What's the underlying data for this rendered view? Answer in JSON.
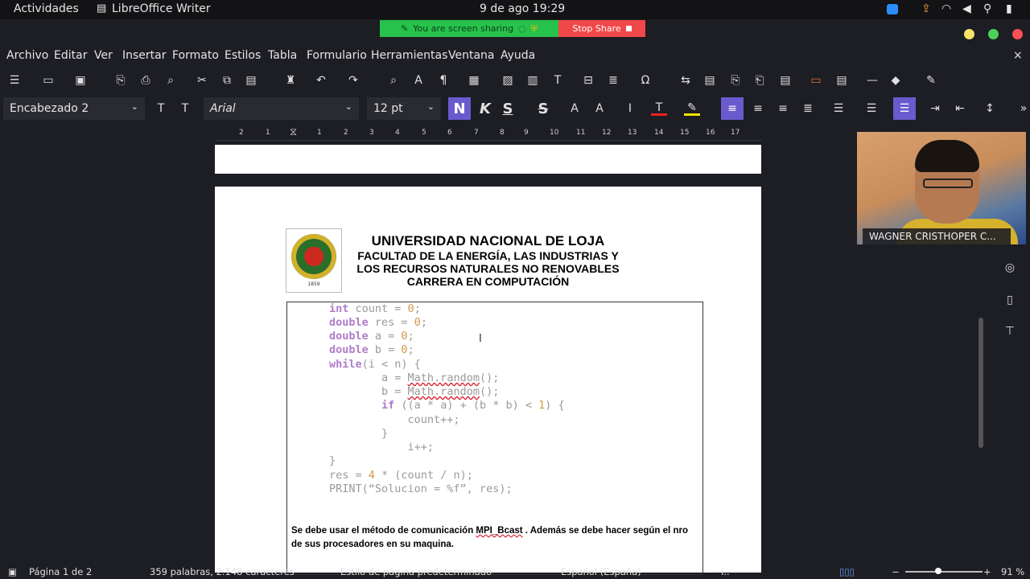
{
  "system_bar": {
    "activities": "Actividades",
    "app_name": "LibreOffice Writer",
    "clock": "9 de ago  19:29"
  },
  "screen_share": {
    "status": "You are screen sharing",
    "stop_label": "Stop Share"
  },
  "menu": [
    "Archivo",
    "Editar",
    "Ver",
    "Insertar",
    "Formato",
    "Estilos",
    "Tabla",
    "Formulario",
    "Herramientas",
    "Ventana",
    "Ayuda"
  ],
  "formatting": {
    "paragraph_style": "Encabezado 2",
    "font_name": "Arial",
    "font_size": "12 pt",
    "bold_label": "N",
    "italic_label": "K",
    "underline_label": "S",
    "strike_label": "S"
  },
  "ruler_numbers": [
    "2",
    "1",
    "1",
    "2",
    "3",
    "4",
    "5",
    "6",
    "7",
    "8",
    "9",
    "10",
    "11",
    "12",
    "13",
    "14",
    "15",
    "16",
    "17"
  ],
  "document": {
    "heading1": "UNIVERSIDAD NACIONAL DE LOJA",
    "heading2": "FACULTAD DE  LA ENERGÍA, LAS INDUSTRIAS Y",
    "heading3": "LOS RECURSOS NATURALES NO RENOVABLES",
    "heading4": "CARRERA EN COMPUTACIÓN",
    "logo_year": "1859",
    "code": {
      "l1_kw": "int",
      "l1_rest": " count = ",
      "l1_num": "0",
      "l1_end": ";",
      "l2_kw": "double",
      "l2_rest": " res = ",
      "l2_num": "0",
      "l2_end": ";",
      "l3_kw": "double",
      "l3_rest": " a = ",
      "l3_num": "0",
      "l3_end": ";",
      "l4_kw": "double",
      "l4_rest": " b = ",
      "l4_num": "0",
      "l4_end": ";",
      "l5_kw": "while",
      "l5_rest": "(i < n) {",
      "l6_pre": "        a = ",
      "l6_sq": "Math.random",
      "l6_end": "();",
      "l7_pre": "        b = ",
      "l7_sq": "Math.random",
      "l7_end": "();",
      "l8_pre": "        ",
      "l8_kw": "if",
      "l8_rest": " ((a * a) + (b * b) < ",
      "l8_num": "1",
      "l8_end": ") {",
      "l9": "            count++;",
      "l10": "        }",
      "l11": "            i++;",
      "l12": "}",
      "l13_pre": "res = ",
      "l13_num": "4",
      "l13_end": " * (count / n);",
      "l14": "PRINT(“Solucion = %f”, res);"
    },
    "para_a": "Se debe usar el método de comunicación ",
    "para_sq": "MPI_Bcast",
    "para_b": " . Además se debe hacer según el nro de sus procesadores en su maquina."
  },
  "webcam": {
    "participant": "WAGNER CRISTHOPER C..."
  },
  "status": {
    "page": "Página 1 de 2",
    "words": "359 palabras, 2.148 caracteres",
    "page_style": "Estilo de página predeterminado",
    "language": "Español (España)",
    "zoom": "91 %"
  }
}
